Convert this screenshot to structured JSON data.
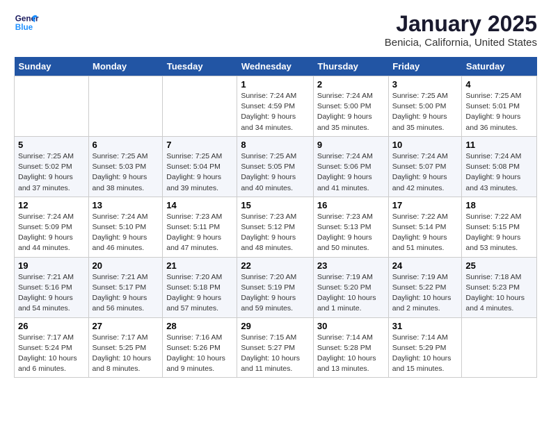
{
  "header": {
    "logo_line1": "General",
    "logo_line2": "Blue",
    "title": "January 2025",
    "subtitle": "Benicia, California, United States"
  },
  "days_of_week": [
    "Sunday",
    "Monday",
    "Tuesday",
    "Wednesday",
    "Thursday",
    "Friday",
    "Saturday"
  ],
  "weeks": [
    [
      {
        "day": "",
        "info": ""
      },
      {
        "day": "",
        "info": ""
      },
      {
        "day": "",
        "info": ""
      },
      {
        "day": "1",
        "info": "Sunrise: 7:24 AM\nSunset: 4:59 PM\nDaylight: 9 hours\nand 34 minutes."
      },
      {
        "day": "2",
        "info": "Sunrise: 7:24 AM\nSunset: 5:00 PM\nDaylight: 9 hours\nand 35 minutes."
      },
      {
        "day": "3",
        "info": "Sunrise: 7:25 AM\nSunset: 5:00 PM\nDaylight: 9 hours\nand 35 minutes."
      },
      {
        "day": "4",
        "info": "Sunrise: 7:25 AM\nSunset: 5:01 PM\nDaylight: 9 hours\nand 36 minutes."
      }
    ],
    [
      {
        "day": "5",
        "info": "Sunrise: 7:25 AM\nSunset: 5:02 PM\nDaylight: 9 hours\nand 37 minutes."
      },
      {
        "day": "6",
        "info": "Sunrise: 7:25 AM\nSunset: 5:03 PM\nDaylight: 9 hours\nand 38 minutes."
      },
      {
        "day": "7",
        "info": "Sunrise: 7:25 AM\nSunset: 5:04 PM\nDaylight: 9 hours\nand 39 minutes."
      },
      {
        "day": "8",
        "info": "Sunrise: 7:25 AM\nSunset: 5:05 PM\nDaylight: 9 hours\nand 40 minutes."
      },
      {
        "day": "9",
        "info": "Sunrise: 7:24 AM\nSunset: 5:06 PM\nDaylight: 9 hours\nand 41 minutes."
      },
      {
        "day": "10",
        "info": "Sunrise: 7:24 AM\nSunset: 5:07 PM\nDaylight: 9 hours\nand 42 minutes."
      },
      {
        "day": "11",
        "info": "Sunrise: 7:24 AM\nSunset: 5:08 PM\nDaylight: 9 hours\nand 43 minutes."
      }
    ],
    [
      {
        "day": "12",
        "info": "Sunrise: 7:24 AM\nSunset: 5:09 PM\nDaylight: 9 hours\nand 44 minutes."
      },
      {
        "day": "13",
        "info": "Sunrise: 7:24 AM\nSunset: 5:10 PM\nDaylight: 9 hours\nand 46 minutes."
      },
      {
        "day": "14",
        "info": "Sunrise: 7:23 AM\nSunset: 5:11 PM\nDaylight: 9 hours\nand 47 minutes."
      },
      {
        "day": "15",
        "info": "Sunrise: 7:23 AM\nSunset: 5:12 PM\nDaylight: 9 hours\nand 48 minutes."
      },
      {
        "day": "16",
        "info": "Sunrise: 7:23 AM\nSunset: 5:13 PM\nDaylight: 9 hours\nand 50 minutes."
      },
      {
        "day": "17",
        "info": "Sunrise: 7:22 AM\nSunset: 5:14 PM\nDaylight: 9 hours\nand 51 minutes."
      },
      {
        "day": "18",
        "info": "Sunrise: 7:22 AM\nSunset: 5:15 PM\nDaylight: 9 hours\nand 53 minutes."
      }
    ],
    [
      {
        "day": "19",
        "info": "Sunrise: 7:21 AM\nSunset: 5:16 PM\nDaylight: 9 hours\nand 54 minutes."
      },
      {
        "day": "20",
        "info": "Sunrise: 7:21 AM\nSunset: 5:17 PM\nDaylight: 9 hours\nand 56 minutes."
      },
      {
        "day": "21",
        "info": "Sunrise: 7:20 AM\nSunset: 5:18 PM\nDaylight: 9 hours\nand 57 minutes."
      },
      {
        "day": "22",
        "info": "Sunrise: 7:20 AM\nSunset: 5:19 PM\nDaylight: 9 hours\nand 59 minutes."
      },
      {
        "day": "23",
        "info": "Sunrise: 7:19 AM\nSunset: 5:20 PM\nDaylight: 10 hours\nand 1 minute."
      },
      {
        "day": "24",
        "info": "Sunrise: 7:19 AM\nSunset: 5:22 PM\nDaylight: 10 hours\nand 2 minutes."
      },
      {
        "day": "25",
        "info": "Sunrise: 7:18 AM\nSunset: 5:23 PM\nDaylight: 10 hours\nand 4 minutes."
      }
    ],
    [
      {
        "day": "26",
        "info": "Sunrise: 7:17 AM\nSunset: 5:24 PM\nDaylight: 10 hours\nand 6 minutes."
      },
      {
        "day": "27",
        "info": "Sunrise: 7:17 AM\nSunset: 5:25 PM\nDaylight: 10 hours\nand 8 minutes."
      },
      {
        "day": "28",
        "info": "Sunrise: 7:16 AM\nSunset: 5:26 PM\nDaylight: 10 hours\nand 9 minutes."
      },
      {
        "day": "29",
        "info": "Sunrise: 7:15 AM\nSunset: 5:27 PM\nDaylight: 10 hours\nand 11 minutes."
      },
      {
        "day": "30",
        "info": "Sunrise: 7:14 AM\nSunset: 5:28 PM\nDaylight: 10 hours\nand 13 minutes."
      },
      {
        "day": "31",
        "info": "Sunrise: 7:14 AM\nSunset: 5:29 PM\nDaylight: 10 hours\nand 15 minutes."
      },
      {
        "day": "",
        "info": ""
      }
    ]
  ]
}
